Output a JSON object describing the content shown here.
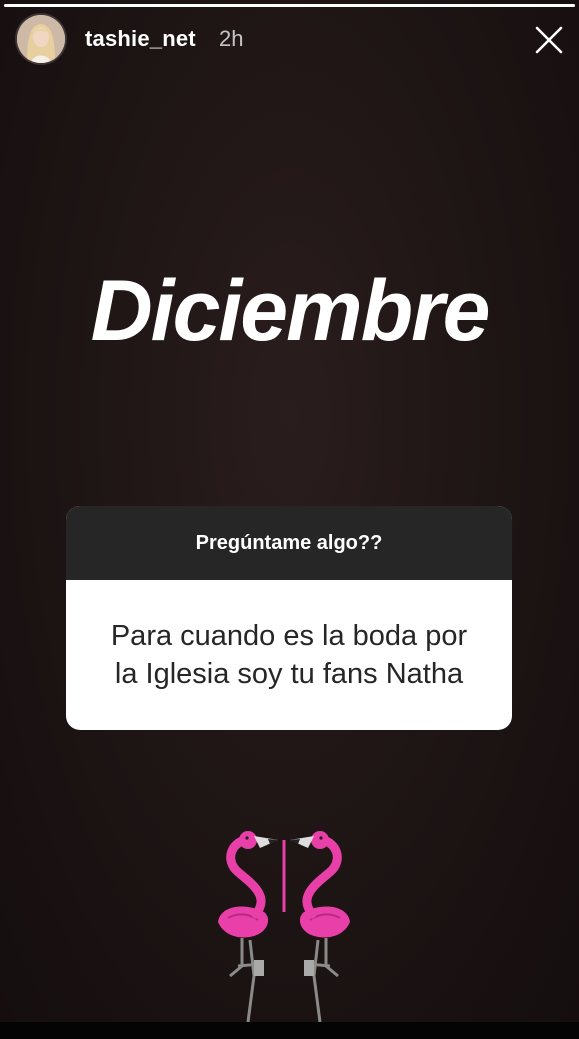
{
  "story": {
    "progress": 1.0,
    "username": "tashie_net",
    "timestamp": "2h",
    "headline": "Diciembre",
    "question_sticker": {
      "prompt": "Pregúntame algo??",
      "answer": "Para cuando es la  boda por\nla Iglesia soy tu fans Natha"
    },
    "sticker_icon": "flamingo-pair-icon"
  },
  "colors": {
    "background": "#1d1414",
    "card_header": "#262626",
    "card_body": "#ffffff",
    "flamingo": "#e83fa8"
  }
}
